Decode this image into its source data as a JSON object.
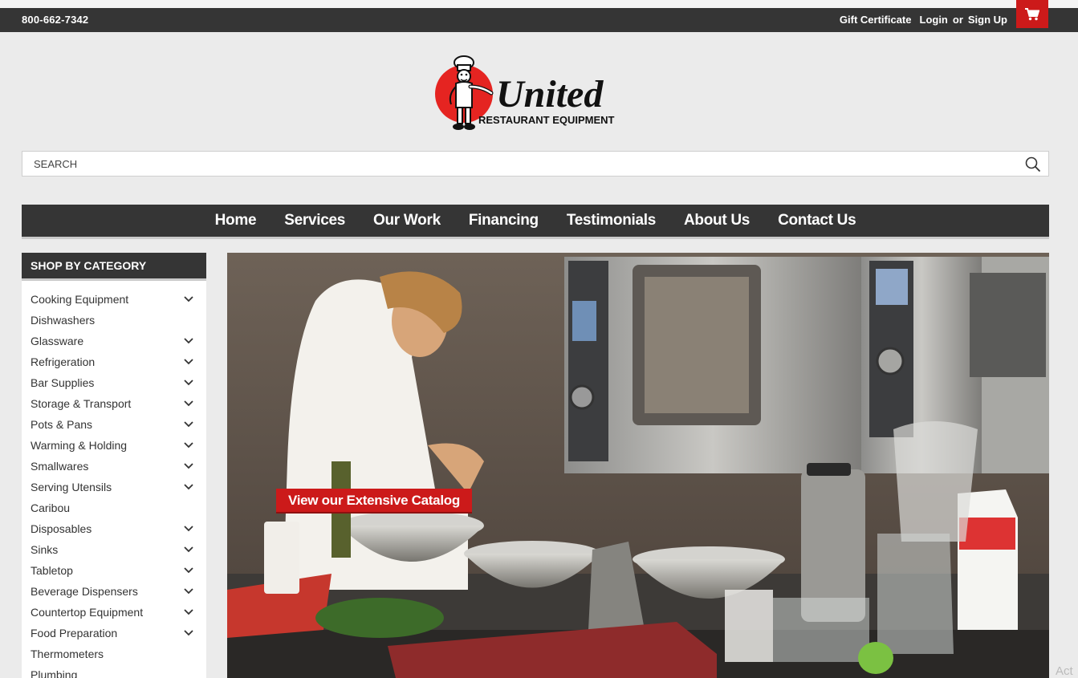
{
  "topbar": {
    "phone": "800-662-7342",
    "gift_certificate": "Gift Certificate",
    "login": "Login",
    "or": "or",
    "sign_up": "Sign Up",
    "cart_icon": "cart-icon"
  },
  "logo": {
    "brand": "United",
    "tagline": "RESTAURANT EQUIPMENT"
  },
  "search": {
    "placeholder": "SEARCH"
  },
  "nav": {
    "items": [
      "Home",
      "Services",
      "Our Work",
      "Financing",
      "Testimonials",
      "About Us",
      "Contact Us"
    ]
  },
  "sidebar": {
    "title": "SHOP BY CATEGORY",
    "items": [
      {
        "label": "Cooking Equipment",
        "expandable": true
      },
      {
        "label": "Dishwashers",
        "expandable": false
      },
      {
        "label": "Glassware",
        "expandable": true
      },
      {
        "label": "Refrigeration",
        "expandable": true
      },
      {
        "label": "Bar Supplies",
        "expandable": true
      },
      {
        "label": "Storage & Transport",
        "expandable": true
      },
      {
        "label": "Pots & Pans",
        "expandable": true
      },
      {
        "label": "Warming & Holding",
        "expandable": true
      },
      {
        "label": "Smallwares",
        "expandable": true
      },
      {
        "label": "Serving Utensils",
        "expandable": true
      },
      {
        "label": "Caribou",
        "expandable": false
      },
      {
        "label": "Disposables",
        "expandable": true
      },
      {
        "label": "Sinks",
        "expandable": true
      },
      {
        "label": "Tabletop",
        "expandable": true
      },
      {
        "label": "Beverage Dispensers",
        "expandable": true
      },
      {
        "label": "Countertop Equipment",
        "expandable": true
      },
      {
        "label": "Food Preparation",
        "expandable": true
      },
      {
        "label": "Thermometers",
        "expandable": false
      },
      {
        "label": "Plumbing",
        "expandable": false
      }
    ]
  },
  "hero": {
    "cta_label": "View our Extensive Catalog"
  },
  "corner_text": "Act",
  "colors": {
    "accent_red": "#cc1a1a",
    "bar_dark": "#353535",
    "page_bg": "#ebebeb"
  }
}
